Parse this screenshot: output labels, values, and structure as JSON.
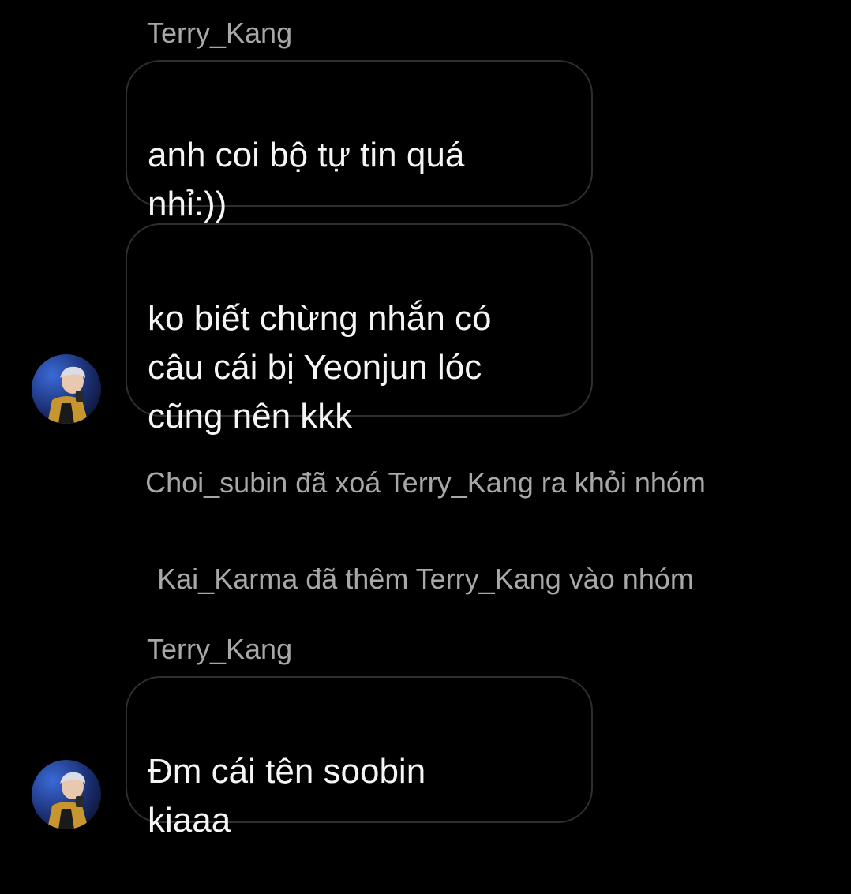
{
  "conversation": {
    "group1": {
      "sender": "Terry_Kang",
      "messages": [
        {
          "text": "anh coi bộ tự tin quá\nnhỉ:))"
        },
        {
          "text": "ko biết chừng nhắn có\ncâu cái bị Yeonjun lóc\ncũng nên kkk"
        }
      ]
    },
    "system_events": [
      {
        "text": "Choi_subin đã xoá Terry_Kang ra khỏi nhóm"
      },
      {
        "text": "Kai_Karma đã thêm Terry_Kang vào nhóm"
      }
    ],
    "group2": {
      "sender": "Terry_Kang",
      "messages": [
        {
          "text": "Đm cái tên soobin\nkiaaa"
        }
      ]
    }
  },
  "colors": {
    "background": "#000000",
    "bubble_border": "#2f2f2f",
    "message_text": "#f5f5f5",
    "meta_text": "#a8a8a8"
  },
  "icons": {
    "avatar": "profile-photo-avatar"
  }
}
